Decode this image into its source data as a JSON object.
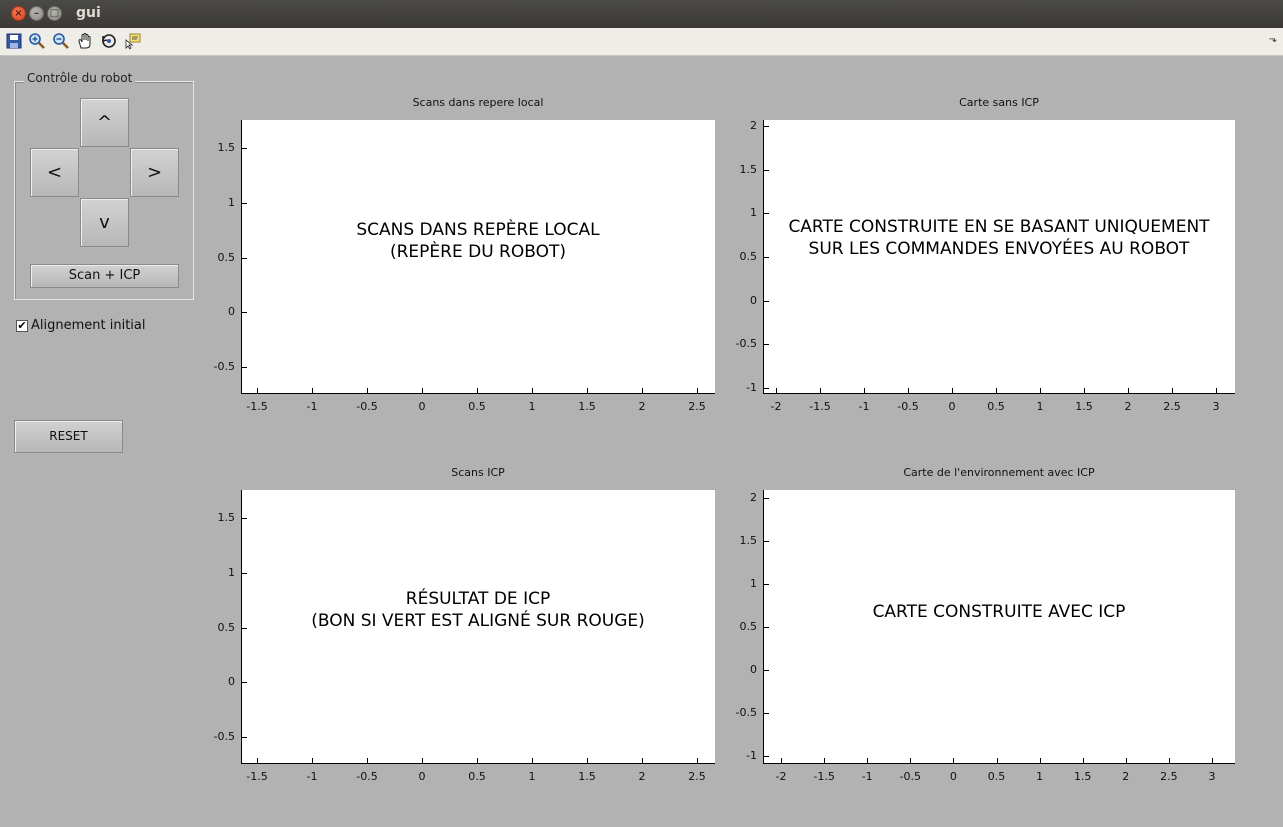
{
  "window": {
    "title": "gui"
  },
  "toolbar": {
    "buttons": [
      "save-icon",
      "zoom-in-icon",
      "zoom-out-icon",
      "pan-hand-icon",
      "rotate-3d-icon",
      "data-cursor-icon"
    ],
    "overflow": "⬎"
  },
  "robot_control": {
    "title": "Contrôle du robot",
    "up": "^",
    "left": "<",
    "right": ">",
    "down": "v",
    "scan_icp": "Scan + ICP"
  },
  "initial_alignment": {
    "label": "Alignement initial",
    "checked": true
  },
  "reset": "RESET",
  "axes": [
    {
      "title": "Scans dans repere local",
      "overlay": [
        "SCANS DANS REPÈRE LOCAL",
        "(REPÈRE DU ROBOT)"
      ],
      "xticks": [
        "-1.5",
        "-1",
        "-0.5",
        "0",
        "0.5",
        "1",
        "1.5",
        "2",
        "2.5"
      ],
      "yticks": [
        "1.5",
        "1",
        "0.5",
        "0",
        "-0.5"
      ]
    },
    {
      "title": "Carte sans ICP",
      "overlay": [
        "CARTE CONSTRUITE EN SE BASANT UNIQUEMENT",
        "SUR LES COMMANDES ENVOYÉES AU ROBOT"
      ],
      "xticks": [
        "-2",
        "-1.5",
        "-1",
        "-0.5",
        "0",
        "0.5",
        "1",
        "1.5",
        "2",
        "2.5",
        "3"
      ],
      "yticks": [
        "2",
        "1.5",
        "1",
        "0.5",
        "0",
        "-0.5",
        "-1"
      ]
    },
    {
      "title": "Scans ICP",
      "overlay": [
        "RÉSULTAT DE ICP",
        "(BON SI VERT EST ALIGNÉ SUR ROUGE)"
      ],
      "xticks": [
        "-1.5",
        "-1",
        "-0.5",
        "0",
        "0.5",
        "1",
        "1.5",
        "2",
        "2.5"
      ],
      "yticks": [
        "1.5",
        "1",
        "0.5",
        "0",
        "-0.5"
      ]
    },
    {
      "title": "Carte de l'environnement avec ICP",
      "overlay": [
        "CARTE CONSTRUITE AVEC ICP"
      ],
      "xticks": [
        "-2",
        "-1.5",
        "-1",
        "-0.5",
        "0",
        "0.5",
        "1",
        "1.5",
        "2",
        "2.5",
        "3"
      ],
      "yticks": [
        "2",
        "1.5",
        "1",
        "0.5",
        "0",
        "-0.5",
        "-1"
      ]
    }
  ]
}
